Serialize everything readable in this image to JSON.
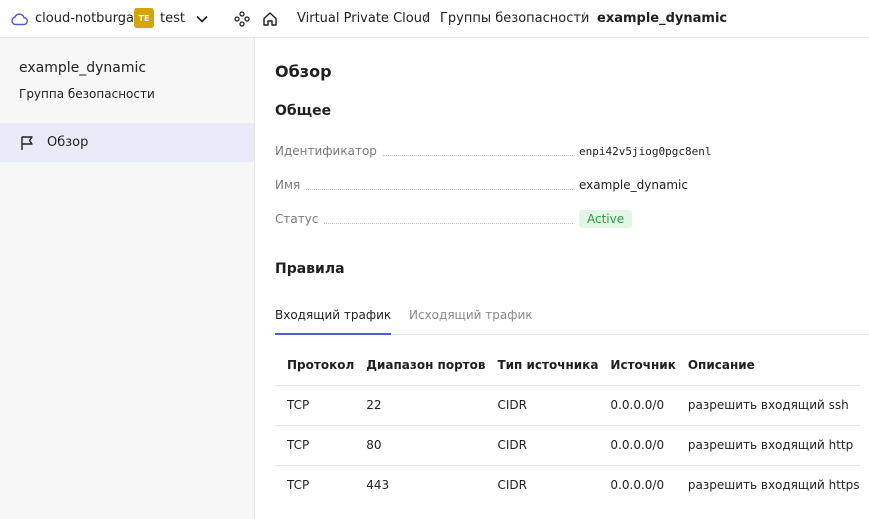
{
  "topbar": {
    "cloud_name": "cloud-notburga",
    "folder_badge": "TE",
    "folder_name": "test",
    "breadcrumbs": [
      "Virtual Private Cloud",
      "Группы безопасности",
      "example_dynamic"
    ],
    "separator": "/"
  },
  "sidebar": {
    "title": "example_dynamic",
    "subtitle": "Группа безопасности",
    "items": [
      {
        "label": "Обзор",
        "icon": "flag-icon",
        "active": true
      }
    ]
  },
  "main": {
    "title": "Обзор",
    "general_heading": "Общее",
    "properties": [
      {
        "key": "Идентификатор",
        "value": "enpi42v5jiog0pgc8enl"
      },
      {
        "key": "Имя",
        "value": "example_dynamic"
      },
      {
        "key": "Статус",
        "value": "Active"
      }
    ],
    "rules_heading": "Правила",
    "tabs": [
      {
        "label": "Входящий трафик",
        "active": true
      },
      {
        "label": "Исходящий трафик",
        "active": false
      }
    ],
    "table": {
      "headers": [
        "Протокол",
        "Диапазон портов",
        "Тип источника",
        "Источник",
        "Описание"
      ],
      "rows": [
        [
          "TCP",
          "22",
          "CIDR",
          "0.0.0.0/0",
          "разрешить входящий ssh"
        ],
        [
          "TCP",
          "80",
          "CIDR",
          "0.0.0.0/0",
          "разрешить входящий http"
        ],
        [
          "TCP",
          "443",
          "CIDR",
          "0.0.0.0/0",
          "разрешить входящий https"
        ]
      ]
    }
  },
  "colors": {
    "accent": "#4b5fc7",
    "folder_badge": "#d4a500",
    "status_active_bg": "#e3f5e6",
    "status_active_text": "#2e9a3e",
    "sidebar_active_bg": "#e9eaf7"
  }
}
